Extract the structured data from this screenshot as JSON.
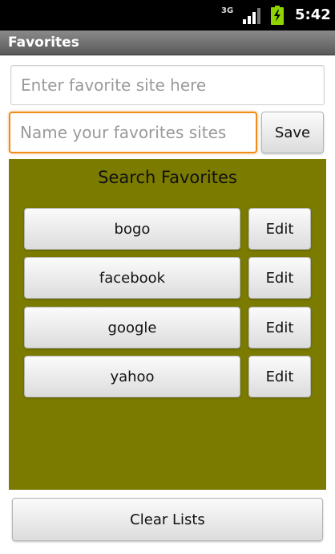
{
  "status_bar": {
    "network_label": "3G",
    "time": "5:42",
    "signal_icon": "signal-icon",
    "battery_icon": "battery-charging-icon"
  },
  "app": {
    "title": "Favorites"
  },
  "form": {
    "url_placeholder": "Enter favorite site here",
    "name_placeholder": "Name your favorites sites",
    "save_label": "Save"
  },
  "favorites": {
    "title": "Search Favorites",
    "items": [
      {
        "name": "bogo",
        "edit_label": "Edit"
      },
      {
        "name": "facebook",
        "edit_label": "Edit"
      },
      {
        "name": "google",
        "edit_label": "Edit"
      },
      {
        "name": "yahoo",
        "edit_label": "Edit"
      }
    ]
  },
  "clear_label": "Clear Lists",
  "colors": {
    "panel_background": "#7b7b00",
    "focus_border": "#f08c1a",
    "battery": "#8fd400"
  }
}
